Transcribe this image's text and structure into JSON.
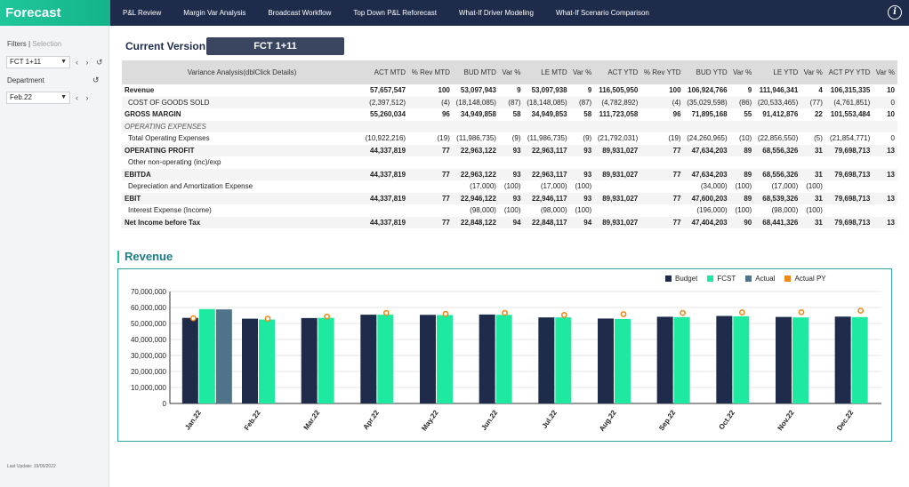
{
  "app": {
    "title": "Forecast"
  },
  "nav": {
    "items": [
      "P&L Review",
      "Margin Var Analysis",
      "Broadcast Workflow",
      "Top Down P&L Reforecast",
      "What-If Driver Modeling",
      "What-If Scenario Comparison"
    ],
    "info_icon": "info-icon"
  },
  "sidebar": {
    "filters_label": "Filters",
    "selection_label": "Selection",
    "version_select": "FCT 1+11",
    "department_label": "Department",
    "period_select": "Feb.22",
    "last_update": "Last Update: 19/05/2022"
  },
  "main": {
    "current_version_label": "Current Version",
    "current_version_value": "FCT 1+11",
    "section_title": "Revenue"
  },
  "table": {
    "headers": [
      "Variance Analysis(dblClick Details)",
      "ACT MTD",
      "% Rev MTD",
      "BUD MTD",
      "Var %",
      "LE MTD",
      "Var %",
      "ACT YTD",
      "% Rev YTD",
      "BUD YTD",
      "Var %",
      "LE YTD",
      "Var %",
      "ACT PY YTD",
      "Var %"
    ],
    "rows": [
      {
        "style": "bold",
        "cells": [
          "Revenue",
          "57,657,547",
          "100",
          "53,097,943",
          "9",
          "53,097,938",
          "9",
          "116,505,950",
          "100",
          "106,924,766",
          "9",
          "111,946,341",
          "4",
          "106,315,335",
          "10"
        ]
      },
      {
        "style": "sub",
        "cells": [
          "COST OF GOODS SOLD",
          "(2,397,512)",
          "(4)",
          "(18,148,085)",
          "(87)",
          "(18,148,085)",
          "(87)",
          "(4,782,892)",
          "(4)",
          "(35,029,598)",
          "(86)",
          "(20,533,465)",
          "(77)",
          "(4,761,851)",
          "0"
        ]
      },
      {
        "style": "bold",
        "cells": [
          "GROSS MARGIN",
          "55,260,034",
          "96",
          "34,949,858",
          "58",
          "34,949,853",
          "58",
          "111,723,058",
          "96",
          "71,895,168",
          "55",
          "91,412,876",
          "22",
          "101,553,484",
          "10"
        ]
      },
      {
        "style": "italic",
        "cells": [
          "OPERATING EXPENSES",
          "",
          "",
          "",
          "",
          "",
          "",
          "",
          "",
          "",
          "",
          "",
          "",
          "",
          ""
        ]
      },
      {
        "style": "sub",
        "cells": [
          "Total Operating Expenses",
          "(10,922,216)",
          "(19)",
          "(11,986,735)",
          "(9)",
          "(11,986,735)",
          "(9)",
          "(21,792,031)",
          "(19)",
          "(24,260,965)",
          "(10)",
          "(22,856,550)",
          "(5)",
          "(21,854,771)",
          "0"
        ]
      },
      {
        "style": "bold",
        "cells": [
          "OPERATING PROFIT",
          "44,337,819",
          "77",
          "22,963,122",
          "93",
          "22,963,117",
          "93",
          "89,931,027",
          "77",
          "47,634,203",
          "89",
          "68,556,326",
          "31",
          "79,698,713",
          "13"
        ]
      },
      {
        "style": "sub",
        "cells": [
          "Other non-operating (inc)/exp",
          "",
          "",
          "",
          "",
          "",
          "",
          "",
          "",
          "",
          "",
          "",
          "",
          "",
          ""
        ]
      },
      {
        "style": "bold",
        "cells": [
          "EBITDA",
          "44,337,819",
          "77",
          "22,963,122",
          "93",
          "22,963,117",
          "93",
          "89,931,027",
          "77",
          "47,634,203",
          "89",
          "68,556,326",
          "31",
          "79,698,713",
          "13"
        ]
      },
      {
        "style": "sub",
        "cells": [
          "Depreciation and Amortization Expense",
          "",
          "",
          "(17,000)",
          "(100)",
          "(17,000)",
          "(100)",
          "",
          "",
          "(34,000)",
          "(100)",
          "(17,000)",
          "(100)",
          "",
          ""
        ]
      },
      {
        "style": "bold",
        "cells": [
          "EBIT",
          "44,337,819",
          "77",
          "22,946,122",
          "93",
          "22,946,117",
          "93",
          "89,931,027",
          "77",
          "47,600,203",
          "89",
          "68,539,326",
          "31",
          "79,698,713",
          "13"
        ]
      },
      {
        "style": "sub",
        "cells": [
          "Interest Expense (Income)",
          "",
          "",
          "(98,000)",
          "(100)",
          "(98,000)",
          "(100)",
          "",
          "",
          "(196,000)",
          "(100)",
          "(98,000)",
          "(100)",
          "",
          ""
        ]
      },
      {
        "style": "bold",
        "cells": [
          "Net Income before Tax",
          "44,337,819",
          "77",
          "22,848,122",
          "94",
          "22,848,117",
          "94",
          "89,931,027",
          "77",
          "47,404,203",
          "90",
          "68,441,326",
          "31",
          "79,698,713",
          "13"
        ]
      }
    ]
  },
  "chart_data": {
    "type": "bar",
    "title": "Revenue",
    "categories": [
      "Jan.22",
      "Feb.22",
      "Mar.22",
      "Apr.22",
      "May.22",
      "Jun.22",
      "Jul.22",
      "Aug.22",
      "Sep.22",
      "Oct.22",
      "Nov.22",
      "Dec.22"
    ],
    "series": [
      {
        "name": "Budget",
        "kind": "bar",
        "color": "#1f2b4b",
        "values": [
          53500000,
          53000000,
          53400000,
          55500000,
          55400000,
          55600000,
          53800000,
          53100000,
          54200000,
          54700000,
          54100000,
          54300000
        ]
      },
      {
        "name": "FCST",
        "kind": "bar",
        "color": "#1de9a0",
        "values": [
          59000000,
          52500000,
          53500000,
          55500000,
          55300000,
          55400000,
          53800000,
          52800000,
          54000000,
          54500000,
          53800000,
          54000000
        ]
      },
      {
        "name": "Actual",
        "kind": "bar",
        "color": "#4f7389",
        "values": [
          58800000,
          null,
          null,
          null,
          null,
          null,
          null,
          null,
          null,
          null,
          null,
          null
        ]
      },
      {
        "name": "Actual PY",
        "kind": "point",
        "color": "#f08a1c",
        "values": [
          53300000,
          53000000,
          54300000,
          56600000,
          56000000,
          56600000,
          55300000,
          55800000,
          56600000,
          56900000,
          57000000,
          58000000
        ]
      }
    ],
    "ylim": [
      0,
      70000000
    ],
    "yticks": [
      "0",
      "10,000,000",
      "20,000,000",
      "30,000,000",
      "40,000,000",
      "50,000,000",
      "60,000,000",
      "70,000,000"
    ],
    "ytick_values": [
      0,
      10000000,
      20000000,
      30000000,
      40000000,
      50000000,
      60000000,
      70000000
    ],
    "legend_position": "top-right",
    "grid": "horizontal"
  }
}
